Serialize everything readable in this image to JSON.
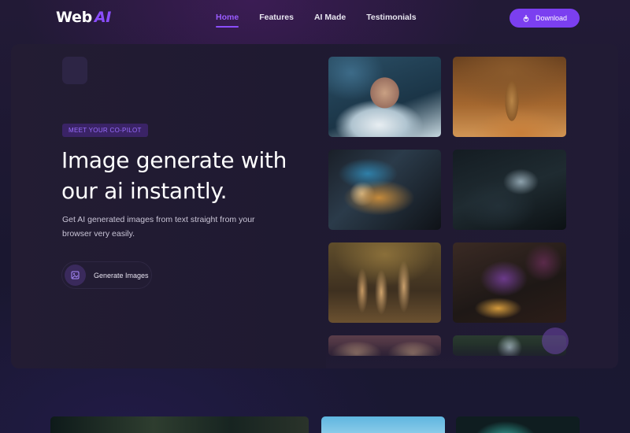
{
  "header": {
    "logo": {
      "text": "Web",
      "accent": "AI"
    },
    "nav": [
      {
        "label": "Home",
        "active": true
      },
      {
        "label": "Features",
        "active": false
      },
      {
        "label": "AI Made",
        "active": false
      },
      {
        "label": "Testimonials",
        "active": false
      }
    ],
    "download_label": "Download"
  },
  "hero": {
    "badge": "MEET YOUR CO-PILOT",
    "title": "Image generate with our ai instantly.",
    "description": "Get AI generated images from text straight from your browser very easily.",
    "cta_label": "Generate Images"
  },
  "gallery": [
    {
      "icon": "boy-in-clouds-image"
    },
    {
      "icon": "meerkat-image"
    },
    {
      "icon": "butterfly-image"
    },
    {
      "icon": "dark-dragon-image"
    },
    {
      "icon": "meerkats-group-image"
    },
    {
      "icon": "purple-dragon-image"
    },
    {
      "icon": "butterfly-wings-image"
    },
    {
      "icon": "forest-image"
    }
  ],
  "colors": {
    "accent": "#7b3ff0",
    "background": "#1c1830",
    "card": "#221c34",
    "badge_bg": "#3a2366"
  }
}
